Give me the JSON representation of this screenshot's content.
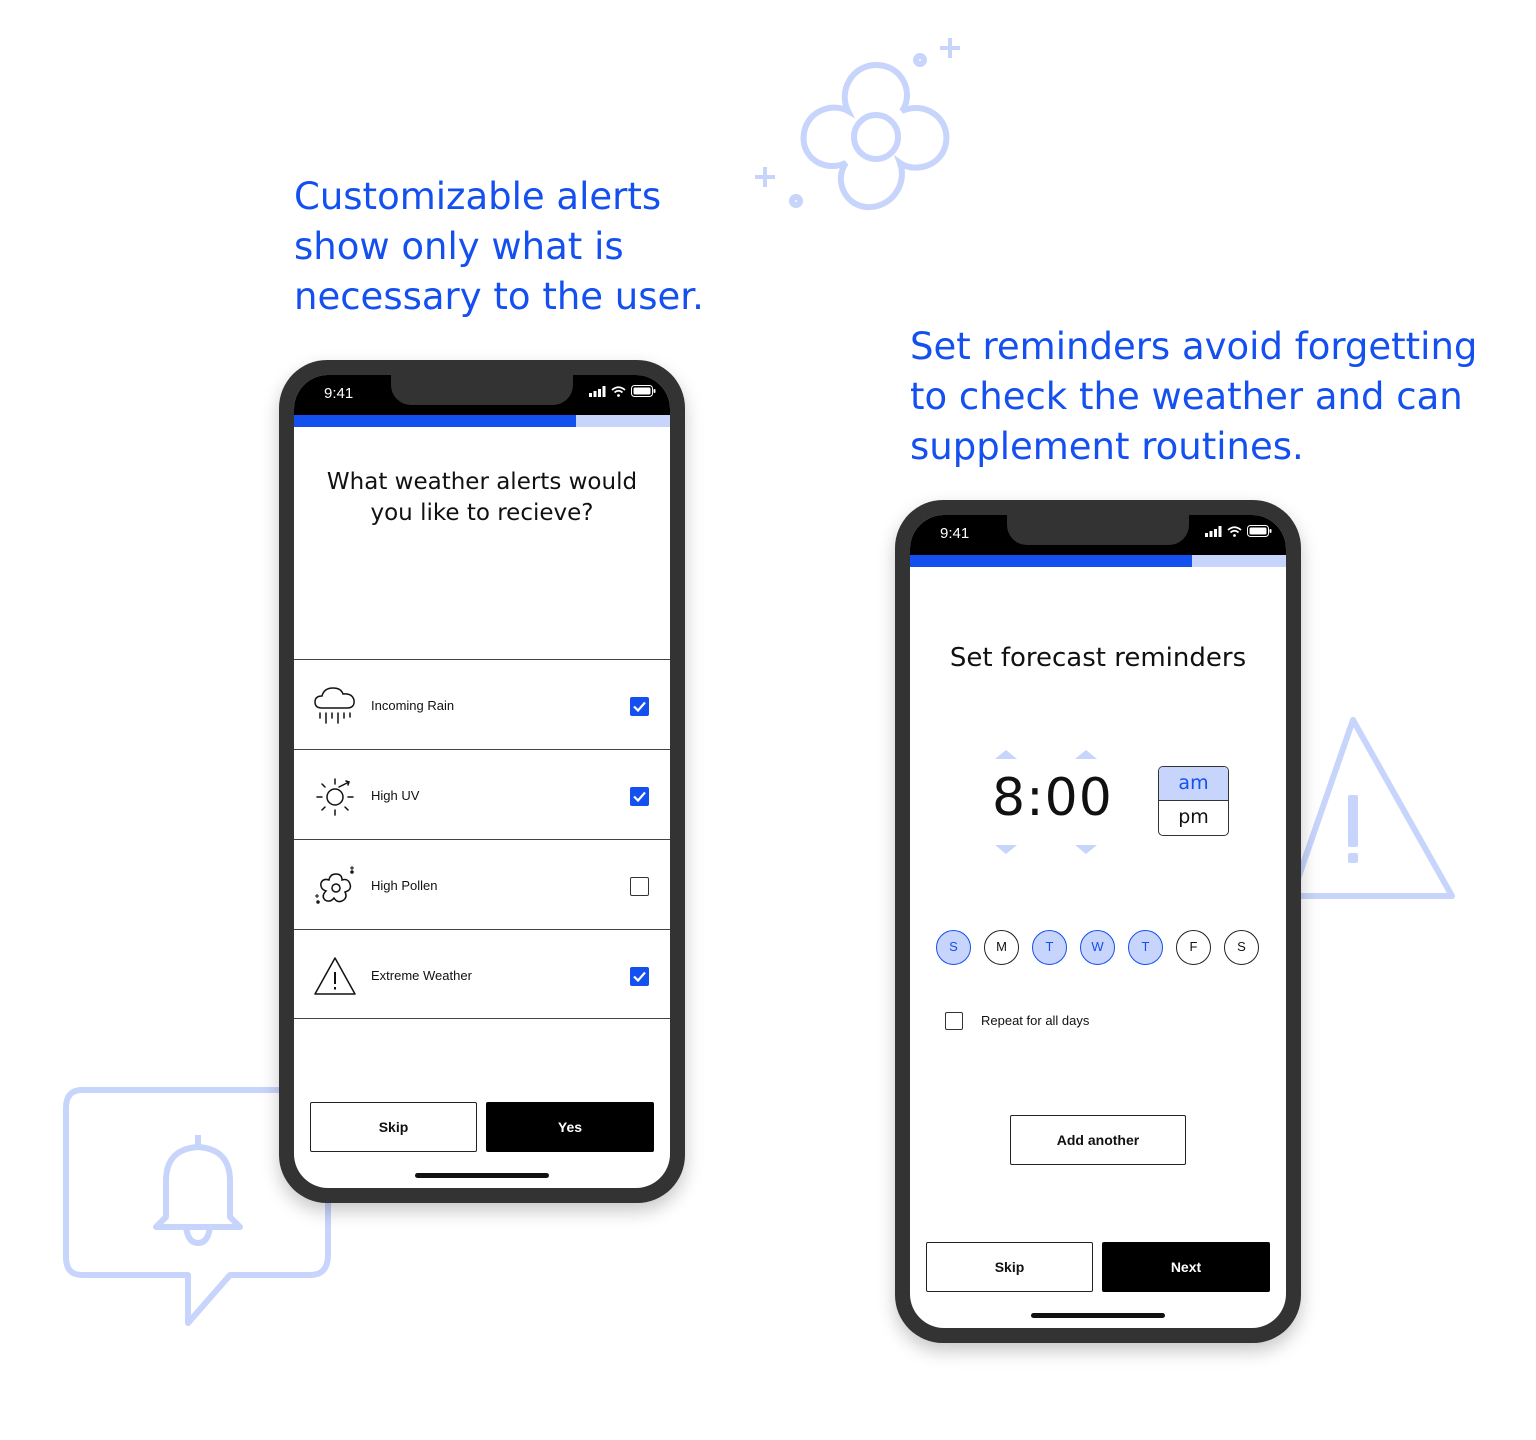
{
  "captions": {
    "left": [
      "Customizable alerts",
      "show only what is",
      "necessary to the user."
    ],
    "right": [
      "Set reminders avoid forgetting",
      "to check the weather and can",
      "supplement routines."
    ]
  },
  "decor_icons": [
    "flower-icon",
    "sparkle-plus-icon",
    "bell-speech-bubble-icon",
    "warning-triangle-icon"
  ],
  "colors": {
    "accent": "#1450f0",
    "accent_light": "#c7d4fb",
    "phone_frame": "#333333"
  },
  "phone_alerts": {
    "status": {
      "time": "9:41"
    },
    "progress": 0.75,
    "question": [
      "What weather alerts would",
      "you like to recieve?"
    ],
    "alerts": [
      {
        "label": "Incoming Rain",
        "icon": "rain-cloud-icon",
        "checked": true
      },
      {
        "label": "High UV",
        "icon": "sun-icon",
        "checked": true
      },
      {
        "label": "High Pollen",
        "icon": "pollen-flower-icon",
        "checked": false
      },
      {
        "label": "Extreme Weather",
        "icon": "warning-icon",
        "checked": true
      }
    ],
    "buttons": {
      "skip": "Skip",
      "yes": "Yes"
    }
  },
  "phone_reminders": {
    "status": {
      "time": "9:41"
    },
    "progress": 0.75,
    "title": "Set forecast reminders",
    "time_value": "8:00",
    "ampm": {
      "am": "am",
      "pm": "pm",
      "selected": "am"
    },
    "days": [
      {
        "label": "S",
        "selected": true
      },
      {
        "label": "M",
        "selected": false
      },
      {
        "label": "T",
        "selected": true
      },
      {
        "label": "W",
        "selected": true
      },
      {
        "label": "T",
        "selected": true
      },
      {
        "label": "F",
        "selected": false
      },
      {
        "label": "S",
        "selected": false
      }
    ],
    "repeat_label": "Repeat for all days",
    "repeat_checked": false,
    "add_another": "Add another",
    "buttons": {
      "skip": "Skip",
      "next": "Next"
    }
  }
}
